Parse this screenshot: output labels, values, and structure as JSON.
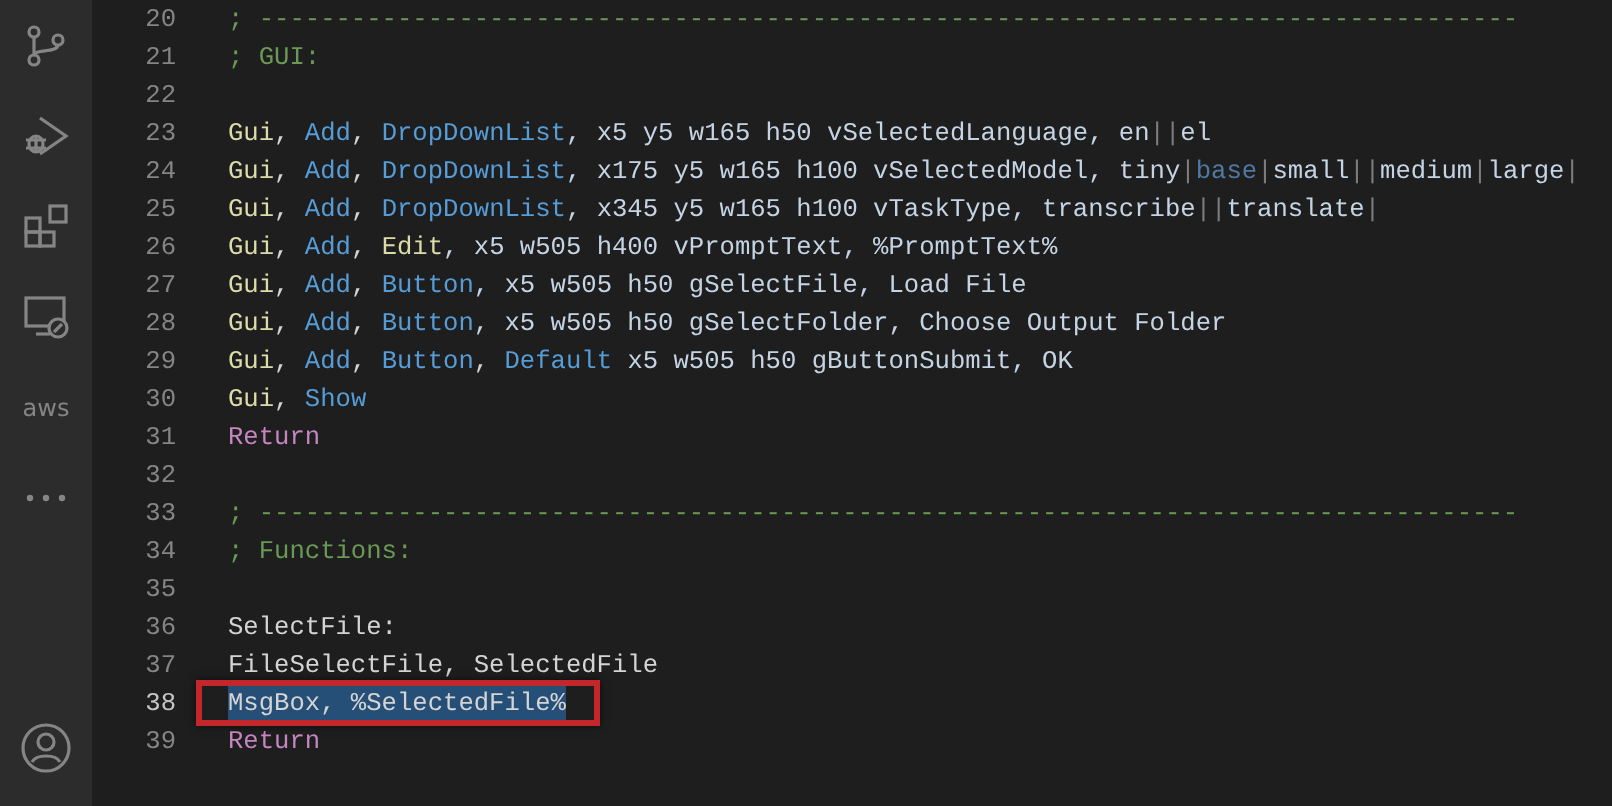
{
  "activity_bar": {
    "items": [
      {
        "kind": "source-control"
      },
      {
        "kind": "run-debug"
      },
      {
        "kind": "extensions"
      },
      {
        "kind": "remote"
      },
      {
        "kind": "text",
        "label": "aws"
      },
      {
        "kind": "more"
      }
    ],
    "account": {
      "kind": "account"
    }
  },
  "editor": {
    "lines": [
      {
        "number": "20",
        "selected": false,
        "tokens": [
          {
            "t": "; ----------------------------------------------------------------------------------",
            "kind": "cmt"
          }
        ]
      },
      {
        "number": "21",
        "selected": false,
        "tokens": [
          {
            "t": "; GUI:",
            "kind": "cmt"
          }
        ]
      },
      {
        "number": "22",
        "selected": false
      },
      {
        "number": "23",
        "selected": false,
        "tokens": [
          {
            "t": "Gui",
            "kind": "fn"
          },
          {
            "t": ", ",
            "kind": "p"
          },
          {
            "t": "Add",
            "kind": "kw"
          },
          {
            "t": ", ",
            "kind": "p"
          },
          {
            "t": "DropDownList",
            "kind": "kw"
          },
          {
            "t": ", x5 y5 w165 h50 vSelectedLanguage, en",
            "kind": "opt"
          },
          {
            "t": "||",
            "kind": "sep"
          },
          {
            "t": "el",
            "kind": "opt"
          }
        ]
      },
      {
        "number": "24",
        "selected": false,
        "tokens": [
          {
            "t": "Gui",
            "kind": "fn"
          },
          {
            "t": ", ",
            "kind": "p"
          },
          {
            "t": "Add",
            "kind": "kw"
          },
          {
            "t": ", ",
            "kind": "p"
          },
          {
            "t": "DropDownList",
            "kind": "kw"
          },
          {
            "t": ", x175 y5 w165 h100 vSelectedModel, tiny",
            "kind": "opt"
          },
          {
            "t": "|",
            "kind": "sep"
          },
          {
            "t": "base",
            "kind": "dim"
          },
          {
            "t": "|",
            "kind": "sep"
          },
          {
            "t": "small",
            "kind": "opt"
          },
          {
            "t": "||",
            "kind": "sep"
          },
          {
            "t": "medium",
            "kind": "opt"
          },
          {
            "t": "|",
            "kind": "sep"
          },
          {
            "t": "large",
            "kind": "opt"
          },
          {
            "t": "|",
            "kind": "sep"
          }
        ]
      },
      {
        "number": "25",
        "selected": false,
        "tokens": [
          {
            "t": "Gui",
            "kind": "fn"
          },
          {
            "t": ", ",
            "kind": "p"
          },
          {
            "t": "Add",
            "kind": "kw"
          },
          {
            "t": ", ",
            "kind": "p"
          },
          {
            "t": "DropDownList",
            "kind": "kw"
          },
          {
            "t": ", x345 y5 w165 h100 vTaskType, transcribe",
            "kind": "opt"
          },
          {
            "t": "||",
            "kind": "sep"
          },
          {
            "t": "translate",
            "kind": "opt"
          },
          {
            "t": "|",
            "kind": "sep"
          }
        ]
      },
      {
        "number": "26",
        "selected": false,
        "tokens": [
          {
            "t": "Gui",
            "kind": "fn"
          },
          {
            "t": ", ",
            "kind": "p"
          },
          {
            "t": "Add",
            "kind": "kw"
          },
          {
            "t": ", ",
            "kind": "p"
          },
          {
            "t": "Edit",
            "kind": "fn"
          },
          {
            "t": ", x5 w505 h400 vPromptText, %PromptText%",
            "kind": "opt"
          }
        ]
      },
      {
        "number": "27",
        "selected": false,
        "tokens": [
          {
            "t": "Gui",
            "kind": "fn"
          },
          {
            "t": ", ",
            "kind": "p"
          },
          {
            "t": "Add",
            "kind": "kw"
          },
          {
            "t": ", ",
            "kind": "p"
          },
          {
            "t": "Button",
            "kind": "kw"
          },
          {
            "t": ", x5 w505 h50 gSelectFile, Load File",
            "kind": "opt"
          }
        ]
      },
      {
        "number": "28",
        "selected": false,
        "tokens": [
          {
            "t": "Gui",
            "kind": "fn"
          },
          {
            "t": ", ",
            "kind": "p"
          },
          {
            "t": "Add",
            "kind": "kw"
          },
          {
            "t": ", ",
            "kind": "p"
          },
          {
            "t": "Button",
            "kind": "kw"
          },
          {
            "t": ", x5 w505 h50 gSelectFolder, Choose Output Folder",
            "kind": "opt"
          }
        ]
      },
      {
        "number": "29",
        "selected": false,
        "tokens": [
          {
            "t": "Gui",
            "kind": "fn"
          },
          {
            "t": ", ",
            "kind": "p"
          },
          {
            "t": "Add",
            "kind": "kw"
          },
          {
            "t": ", ",
            "kind": "p"
          },
          {
            "t": "Button",
            "kind": "kw"
          },
          {
            "t": ", ",
            "kind": "p"
          },
          {
            "t": "Default",
            "kind": "kw"
          },
          {
            "t": " x5 w505 h50 gButtonSubmit, OK",
            "kind": "opt"
          }
        ]
      },
      {
        "number": "30",
        "selected": false,
        "tokens": [
          {
            "t": "Gui",
            "kind": "fn"
          },
          {
            "t": ", ",
            "kind": "p"
          },
          {
            "t": "Show",
            "kind": "kw"
          }
        ]
      },
      {
        "number": "31",
        "selected": false,
        "tokens": [
          {
            "t": "Return",
            "kind": "flow"
          }
        ]
      },
      {
        "number": "32",
        "selected": false
      },
      {
        "number": "33",
        "selected": false,
        "tokens": [
          {
            "t": "; ----------------------------------------------------------------------------------",
            "kind": "cmt"
          }
        ]
      },
      {
        "number": "34",
        "selected": false,
        "tokens": [
          {
            "t": "; Functions:",
            "kind": "cmt"
          }
        ]
      },
      {
        "number": "35",
        "selected": false
      },
      {
        "number": "36",
        "selected": false,
        "tokens": [
          {
            "t": "SelectFile:",
            "kind": "p"
          }
        ]
      },
      {
        "number": "37",
        "selected": false,
        "tokens": [
          {
            "t": "FileSelectFile, SelectedFile",
            "kind": "p"
          }
        ]
      },
      {
        "number": "38",
        "selected": true,
        "tokens": [
          {
            "t": "MsgBox, %SelectedFile%",
            "kind": "p"
          }
        ]
      },
      {
        "number": "39",
        "selected": false,
        "tokens": [
          {
            "t": "Return",
            "kind": "flow"
          }
        ]
      }
    ]
  },
  "annotation": {
    "kind": "red-box"
  }
}
